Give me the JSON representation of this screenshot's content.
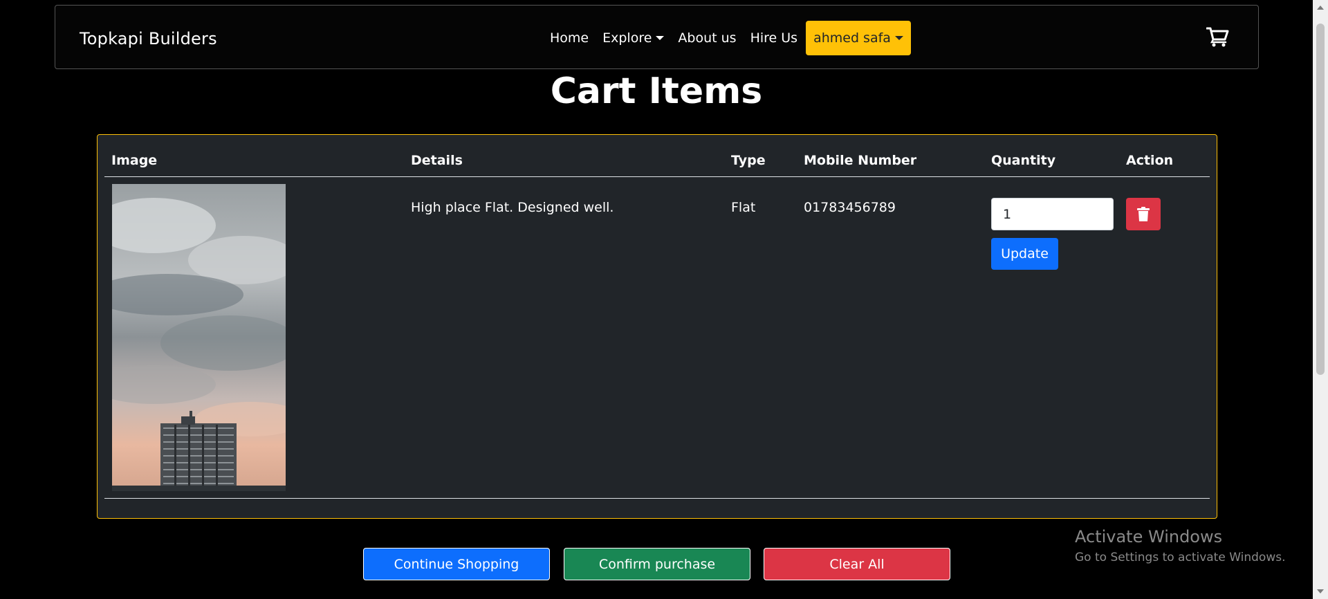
{
  "navbar": {
    "brand": "Topkapi Builders",
    "links": [
      {
        "label": "Home"
      },
      {
        "label": "Explore"
      },
      {
        "label": "About us"
      },
      {
        "label": "Hire Us"
      }
    ],
    "user": "ahmed safa",
    "cart_icon": "cart-plus-icon"
  },
  "page": {
    "title": "Cart Items"
  },
  "table": {
    "headers": [
      "Image",
      "Details",
      "Type",
      "Mobile Number",
      "Quantity",
      "Action"
    ],
    "rows": [
      {
        "image": "building-under-cloudy-sky",
        "details": "High place Flat. Designed well.",
        "type": "Flat",
        "mobile": "01783456789",
        "quantity": "1",
        "update_label": "Update",
        "delete_icon": "trash-icon"
      }
    ]
  },
  "actions": {
    "continue": "Continue Shopping",
    "confirm": "Confirm purchase",
    "clear": "Clear All"
  },
  "colors": {
    "accent": "#ffc107",
    "primary": "#0d6efd",
    "success": "#198754",
    "danger": "#dc3545",
    "card_bg": "#212529"
  },
  "watermark": {
    "title": "Activate Windows",
    "subtitle": "Go to Settings to activate Windows."
  }
}
